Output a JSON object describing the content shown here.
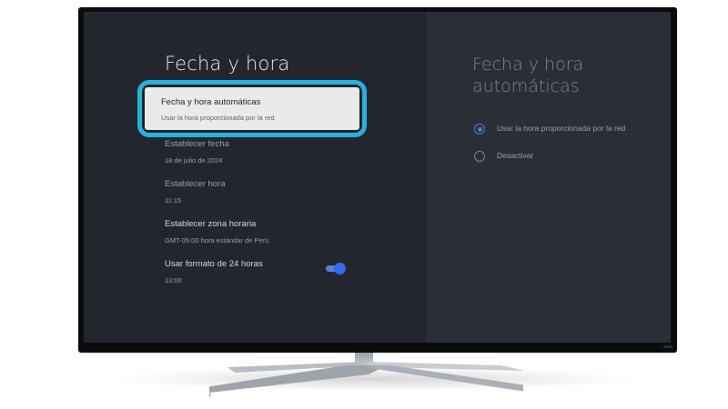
{
  "settings": {
    "title": "Fecha y hora",
    "items": [
      {
        "title": "Fecha y hora automáticas",
        "subtitle": "Usar la hora proporcionada por la red"
      },
      {
        "title": "Establecer fecha",
        "subtitle": "18 de julio de 2024"
      },
      {
        "title": "Establecer hora",
        "subtitle": "11:15"
      },
      {
        "title": "Establecer zona horaria",
        "subtitle": "GMT-05:00 hora estándar de Perú"
      },
      {
        "title": "Usar formato de 24 horas",
        "subtitle": "13:00",
        "toggle_on": true
      }
    ]
  },
  "detail": {
    "title": "Fecha y hora automáticas",
    "options": [
      {
        "label": "Usar la hora proporcionada por la red",
        "selected": true
      },
      {
        "label": "Desactivar",
        "selected": false
      }
    ]
  },
  "colors": {
    "focus_ring": "#23b3df",
    "toggle_on": "#2f6df6",
    "radio_selected": "#4a7fd8",
    "screen_bg": "#23262d"
  }
}
